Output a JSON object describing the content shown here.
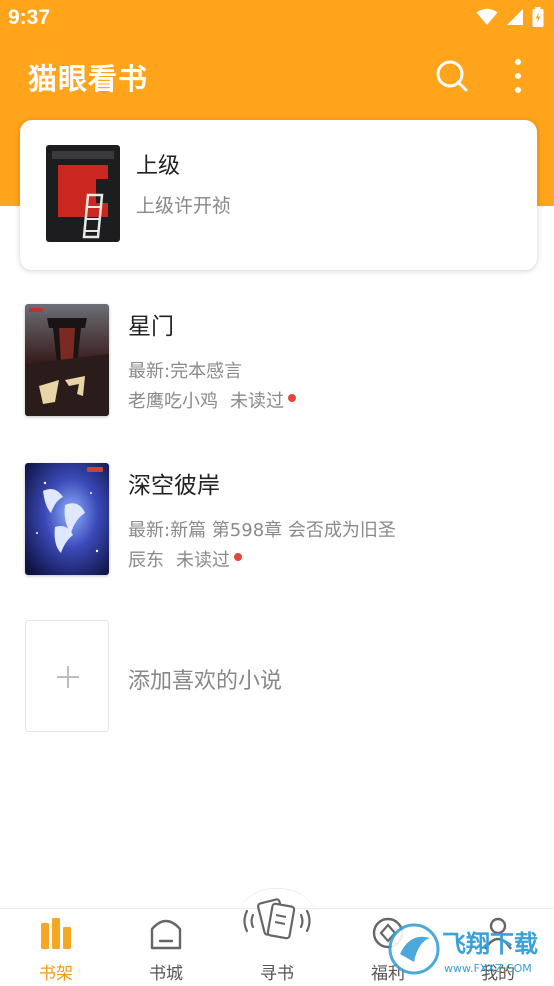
{
  "status_bar": {
    "time": "9:37"
  },
  "app": {
    "title": "猫眼看书"
  },
  "featured": {
    "title": "上级",
    "author": "上级许开祯"
  },
  "books": [
    {
      "title": "星门",
      "latest": "最新:完本感言",
      "author": "老鹰吃小鸡",
      "status": "未读过"
    },
    {
      "title": "深空彼岸",
      "latest": "最新:新篇 第598章 会否成为旧圣",
      "author": "辰东",
      "status": "未读过"
    }
  ],
  "add_book": {
    "label": "添加喜欢的小说"
  },
  "bottom_nav": [
    {
      "label": "书架",
      "icon": "bookshelf-icon",
      "active": true
    },
    {
      "label": "书城",
      "icon": "bookstore-icon",
      "active": false
    },
    {
      "label": "寻书",
      "icon": "find-book-icon",
      "active": false
    },
    {
      "label": "福利",
      "icon": "welfare-icon",
      "active": false
    },
    {
      "label": "我的",
      "icon": "profile-icon",
      "active": false
    }
  ],
  "watermark": {
    "text": "飞翔下载",
    "url_text": "www.FXXZ.COM"
  },
  "colors": {
    "accent": "#FFA41B",
    "active_tab": "#F49A12",
    "unread_dot": "#E8433A"
  }
}
